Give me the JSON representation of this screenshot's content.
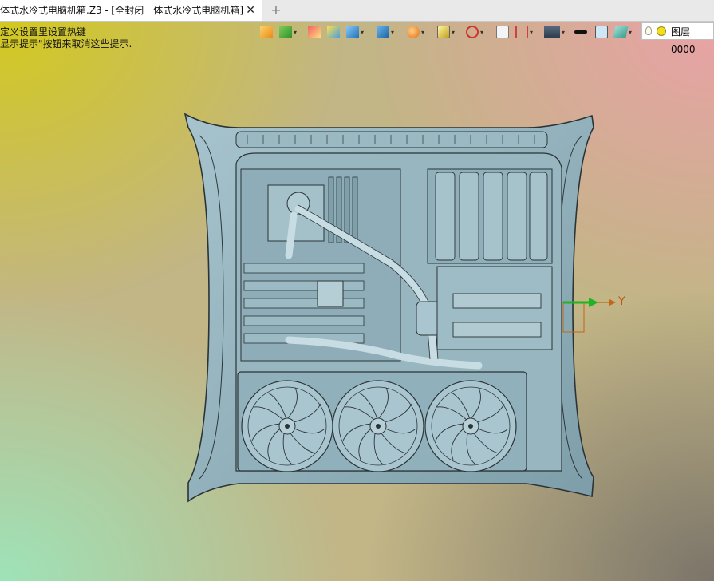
{
  "tab": {
    "title": "体式水冷式电脑机箱.Z3 - [全封闭一体式水冷式电脑机箱]",
    "close_glyph": "✕",
    "new_tab_glyph": "+"
  },
  "hints": {
    "line1": "定义设置里设置热键",
    "line2": "显示提示\"按钮来取消这些提示."
  },
  "toolbar": {
    "icons": [
      "import-icon",
      "chart-icon",
      "pen-icon",
      "block-icon",
      "cube-icon",
      "render-icon",
      "sphere-icon",
      "frame-icon",
      "target-icon",
      "window-icon",
      "dimension-icon",
      "monitor-icon",
      "line-icon",
      "square-icon",
      "layers-icon"
    ],
    "accent": "#2f7fd0"
  },
  "layer": {
    "name": "图层0000"
  },
  "axis": {
    "y_label": "Y",
    "arrow_color": "#22b322"
  },
  "model": {
    "body_color": "#8fb0bb",
    "edge_color": "#2b3336"
  }
}
